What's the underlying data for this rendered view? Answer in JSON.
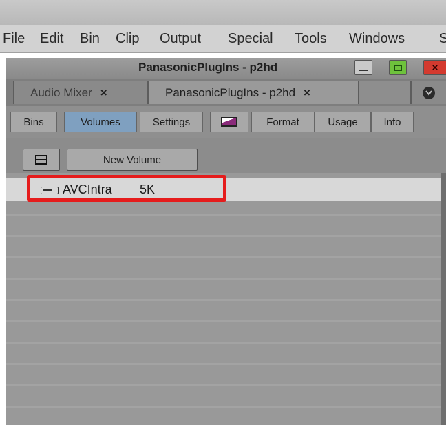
{
  "menubar": {
    "items": [
      "File",
      "Edit",
      "Bin",
      "Clip",
      "Output",
      "Special",
      "Tools",
      "Windows",
      "S"
    ]
  },
  "window": {
    "title": "PanasonicPlugIns - p2hd"
  },
  "tabs": [
    {
      "label": "Audio Mixer",
      "close": "×",
      "active": false
    },
    {
      "label": "PanasonicPlugIns - p2hd",
      "close": "×",
      "active": true
    }
  ],
  "subtabs": [
    "Bins",
    "Volumes",
    "Settings",
    "",
    "Format",
    "Usage",
    "Info"
  ],
  "active_subtab": "Volumes",
  "toolbar": {
    "new_volume_label": "New Volume"
  },
  "volumes": [
    {
      "name": "AVCIntra",
      "size": "5K"
    }
  ],
  "colors": {
    "accent_selected_tab": "#7fa0c0",
    "highlight": "#e51c1c",
    "window_min": "#c9c9c9",
    "window_max": "#6ec23c",
    "window_close": "#d43a2f"
  }
}
